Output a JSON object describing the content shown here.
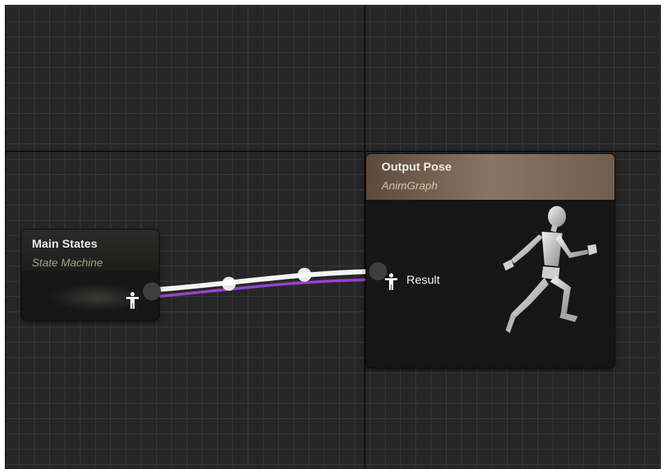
{
  "graph": {
    "nodes": [
      {
        "id": "main-states",
        "title": "Main States",
        "subtitle": "State Machine"
      },
      {
        "id": "output-pose",
        "title": "Output Pose",
        "subtitle": "AnimGraph",
        "pin_label": "Result"
      }
    ],
    "colors": {
      "background": "#262626",
      "node_body": "#151615",
      "output_header": "#7d6a5a",
      "wire_exec": "#ffffff",
      "wire_secondary": "#9b3fd1",
      "subtitle": "#a6a180"
    },
    "icons": {
      "pose_pin": "pose-pin-icon",
      "mannequin": "running-mannequin-icon"
    }
  }
}
